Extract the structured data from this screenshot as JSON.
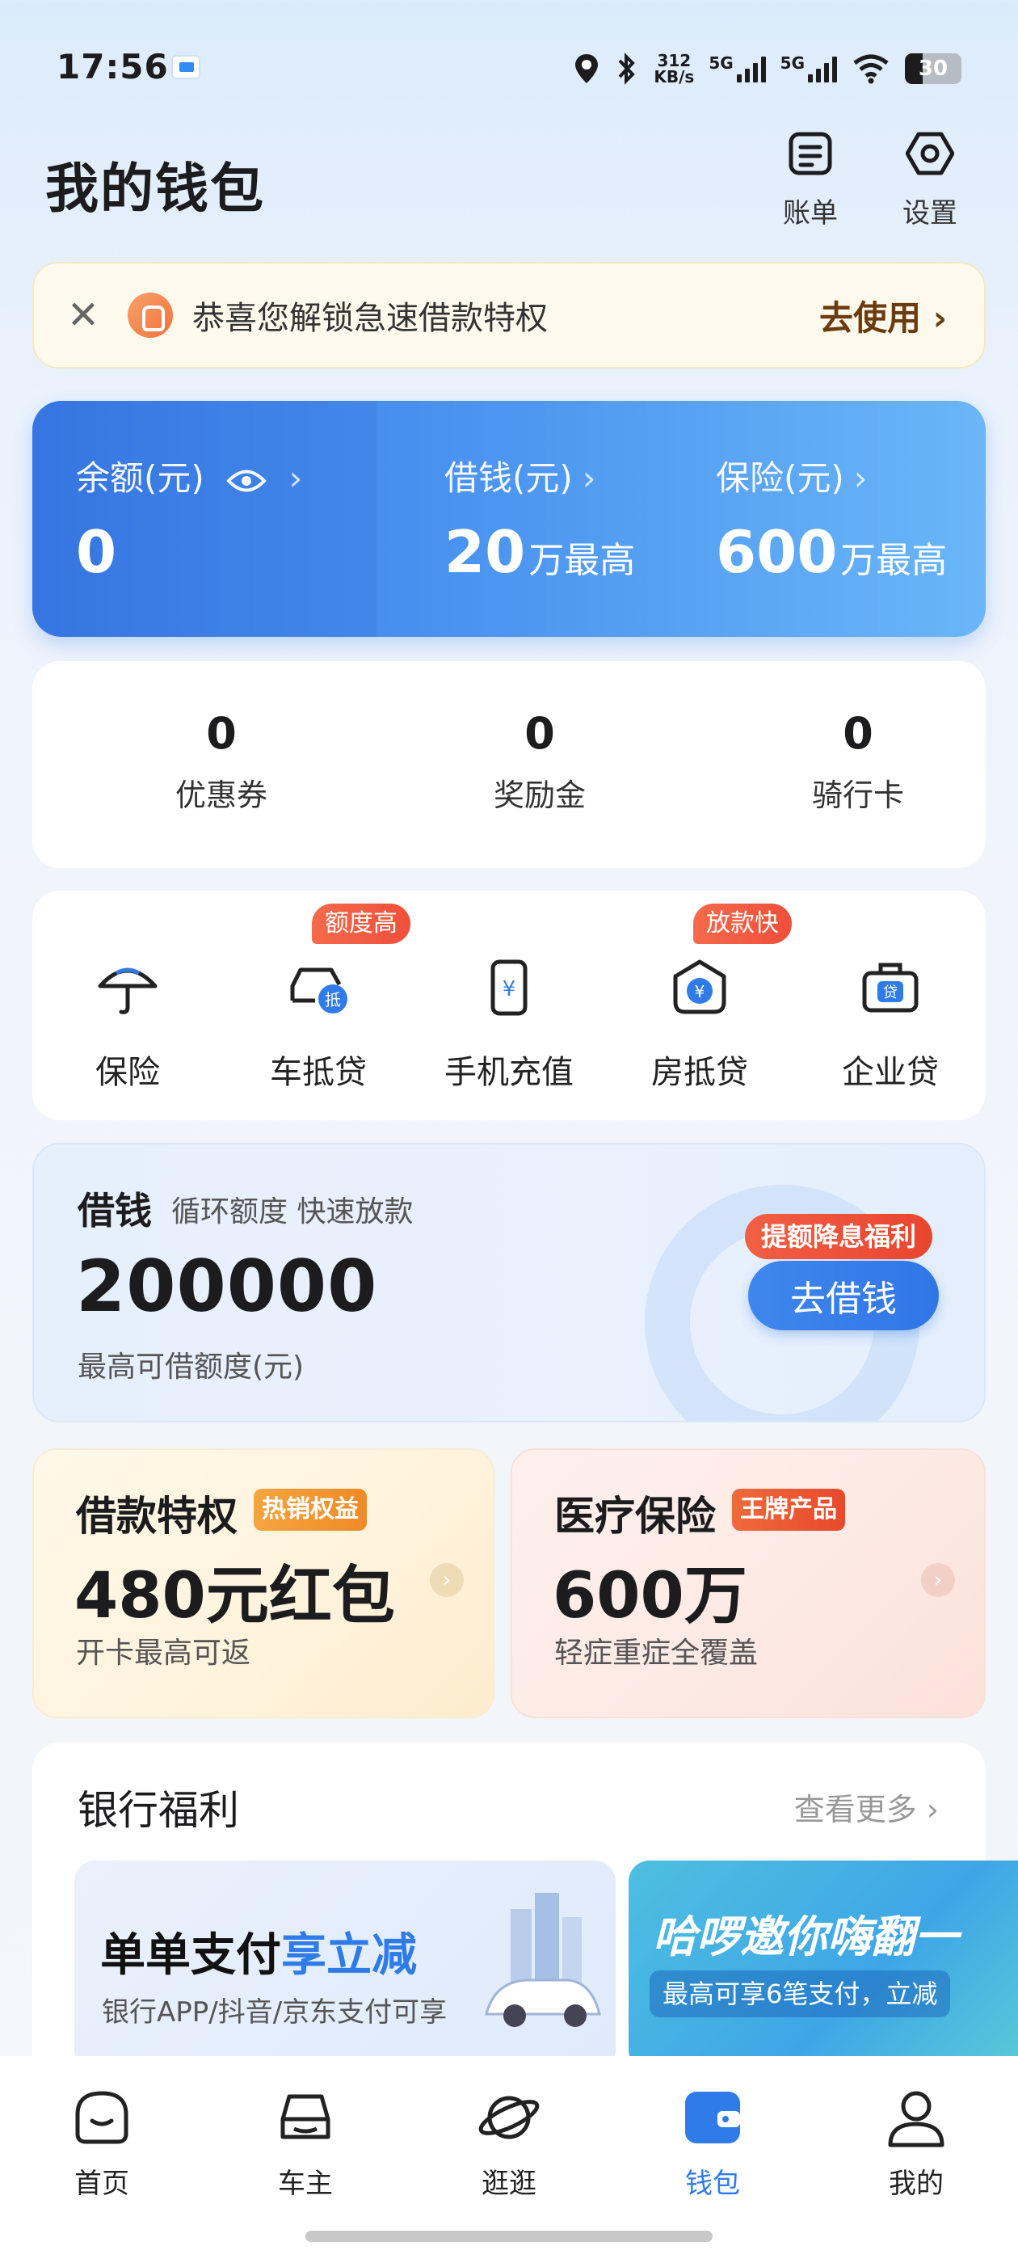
{
  "status_bar": {
    "time": "17:56",
    "net_speed_value": "312",
    "net_speed_unit": "KB/s",
    "sim1": "5G",
    "sim2": "5G",
    "battery": "30"
  },
  "header": {
    "title": "我的钱包",
    "bill_label": "账单",
    "settings_label": "设置"
  },
  "banner": {
    "text": "恭喜您解锁急速借款特权",
    "cta": "去使用"
  },
  "balance_card": {
    "balance_label": "余额(元)",
    "balance_value": "0",
    "borrow_label": "借钱(元)",
    "borrow_value": "20",
    "borrow_unit": "万最高",
    "insurance_label": "保险(元)",
    "insurance_value": "600",
    "insurance_unit": "万最高"
  },
  "stats": [
    {
      "value": "0",
      "label": "优惠券"
    },
    {
      "value": "0",
      "label": "奖励金"
    },
    {
      "value": "0",
      "label": "骑行卡"
    }
  ],
  "services": [
    {
      "label": "保险",
      "icon": "umbrella-icon"
    },
    {
      "label": "车抵贷",
      "icon": "car-loan-icon",
      "badge": "额度高"
    },
    {
      "label": "手机充值",
      "icon": "phone-recharge-icon"
    },
    {
      "label": "房抵贷",
      "icon": "house-loan-icon",
      "badge": "放款快"
    },
    {
      "label": "企业贷",
      "icon": "enterprise-loan-icon"
    }
  ],
  "borrow_card": {
    "title": "借钱",
    "subtitle": "循环额度 快速放款",
    "amount": "200000",
    "note": "最高可借额度(元)",
    "tag": "提额降息福利",
    "button": "去借钱"
  },
  "promos": [
    {
      "title": "借款特权",
      "tag": "热销权益",
      "big": "480元红包",
      "sub": "开卡最高可返"
    },
    {
      "title": "医疗保险",
      "tag": "王牌产品",
      "big": "600万",
      "sub": "轻症重症全覆盖"
    }
  ],
  "bank": {
    "title": "银行福利",
    "more": "查看更多",
    "ad1_title_a": "单单支付",
    "ad1_title_b": "享立减",
    "ad1_sub": "银行APP/抖音/京东支付可享",
    "ad2_title": "哈啰邀你嗨翻一",
    "ad2_sub": "最高可享6笔支付，立减"
  },
  "tabs": [
    {
      "label": "首页",
      "icon": "home-icon"
    },
    {
      "label": "车主",
      "icon": "car-icon"
    },
    {
      "label": "逛逛",
      "icon": "planet-icon"
    },
    {
      "label": "钱包",
      "icon": "wallet-icon"
    },
    {
      "label": "我的",
      "icon": "profile-icon"
    }
  ],
  "colors": {
    "accent": "#2f7be8",
    "badge_red": "#ef4f3a",
    "tag_orange": "#f29a2e"
  }
}
